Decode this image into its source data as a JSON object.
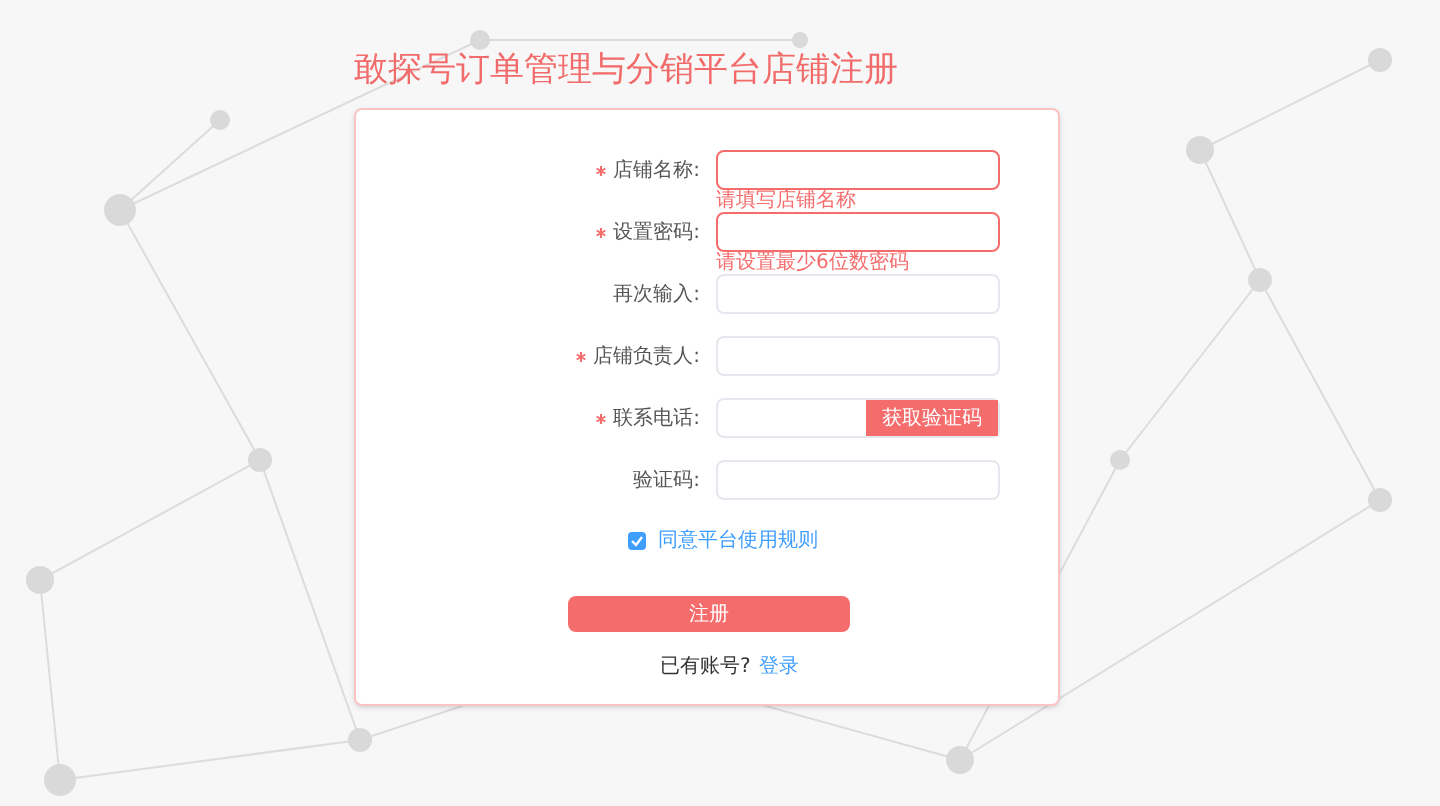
{
  "title": "敢探号订单管理与分销平台店铺注册",
  "fields": [
    {
      "kind": "text",
      "label": "店铺名称:",
      "required": true,
      "error": "请填写店铺名称"
    },
    {
      "kind": "text",
      "label": "设置密码:",
      "required": true,
      "error": "请设置最少6位数密码"
    },
    {
      "kind": "text",
      "label": "再次输入:",
      "required": false
    },
    {
      "kind": "text",
      "label": "店铺负责人:",
      "required": true
    },
    {
      "kind": "phone",
      "label": "联系电话:",
      "required": true,
      "button": "获取验证码"
    },
    {
      "kind": "text",
      "label": "验证码:",
      "required": false
    }
  ],
  "agree": {
    "label": "同意平台使用规则",
    "checked": true
  },
  "submit": "注册",
  "login": {
    "prompt": "已有账号?",
    "link": "登录"
  }
}
